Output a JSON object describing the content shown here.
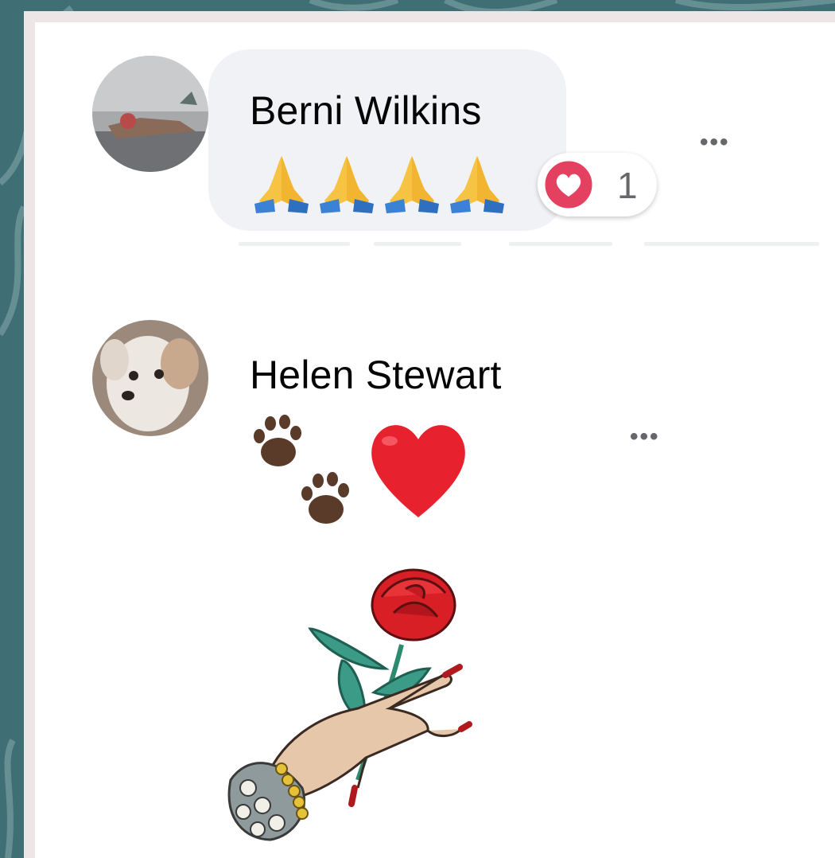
{
  "comments": [
    {
      "author": "Berni Wilkins",
      "emoji_text": "🙏🙏🙏🙏",
      "reaction": {
        "icon": "heart-reaction-icon",
        "count": "1",
        "color": "#e4405f"
      },
      "more_label": "•••"
    },
    {
      "author": "Helen Stewart",
      "emoji_text": "🐾❤️",
      "sticker": "rose-in-hand-sticker",
      "more_label": "•••"
    }
  ],
  "colors": {
    "background": "#3f6f75",
    "card": "#ffffff",
    "bubble": "#f0f2f5",
    "text": "#050505",
    "meta": "#65676b"
  }
}
